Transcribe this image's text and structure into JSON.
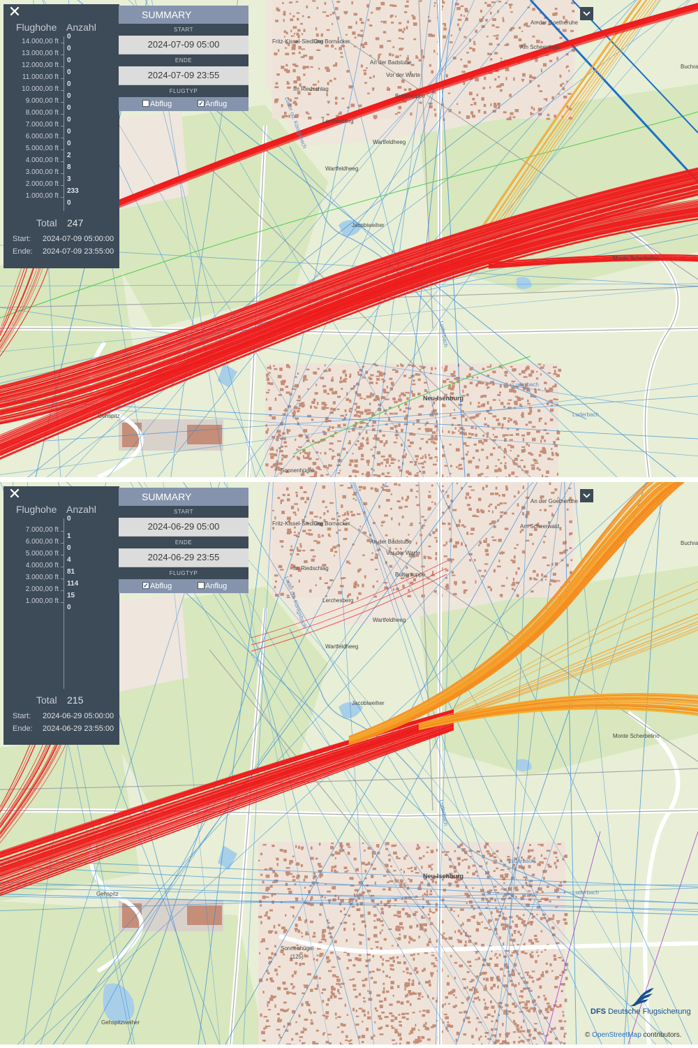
{
  "top_panel": {
    "header": {
      "col_altitude": "Flughohe",
      "col_count": "Anzahl"
    },
    "rows": [
      {
        "altitude": "14.000,00 ft",
        "count": "0"
      },
      {
        "altitude": "13.000,00 ft",
        "count": "0"
      },
      {
        "altitude": "12.000,00 ft",
        "count": "0"
      },
      {
        "altitude": "11.000,00 ft",
        "count": "0"
      },
      {
        "altitude": "10.000,00 ft",
        "count": "0"
      },
      {
        "altitude": "9.000,00 ft",
        "count": "0"
      },
      {
        "altitude": "8.000,00 ft",
        "count": "0"
      },
      {
        "altitude": "7.000,00 ft",
        "count": "0"
      },
      {
        "altitude": "6.000,00 ft",
        "count": "0"
      },
      {
        "altitude": "5.000,00 ft",
        "count": "0"
      },
      {
        "altitude": "4.000,00 ft",
        "count": "2"
      },
      {
        "altitude": "3.000,00 ft",
        "count": "8"
      },
      {
        "altitude": "2.000,00 ft",
        "count": "3"
      },
      {
        "altitude": "1.000,00 ft",
        "count": "233"
      },
      {
        "altitude": "",
        "count": "0"
      }
    ],
    "total_label": "Total",
    "total": "247",
    "start_label": "Start:",
    "start": "2024-07-09 05:00:00",
    "end_label": "Ende:",
    "end": "2024-07-09 23:55:00",
    "summary": {
      "title": "SUMMARY",
      "start_label": "START",
      "start": "2024-07-09 05:00",
      "end_label": "ENDE",
      "end": "2024-07-09 23:55",
      "type_label": "FLUGTYP",
      "departure_label": "Abflug",
      "departure_checked": false,
      "arrival_label": "Anflug",
      "arrival_checked": true
    }
  },
  "bottom_panel": {
    "header": {
      "col_altitude": "Flughohe",
      "col_count": "Anzahl"
    },
    "rows": [
      {
        "altitude": "",
        "count": "0"
      },
      {
        "altitude": "7.000,00 ft",
        "count": "1"
      },
      {
        "altitude": "6.000,00 ft",
        "count": "0"
      },
      {
        "altitude": "5.000,00 ft",
        "count": "4"
      },
      {
        "altitude": "4.000,00 ft",
        "count": "81"
      },
      {
        "altitude": "3.000,00 ft",
        "count": "114"
      },
      {
        "altitude": "2.000,00 ft",
        "count": "15"
      },
      {
        "altitude": "1.000,00 ft",
        "count": "0"
      }
    ],
    "total_label": "Total",
    "total": "215",
    "start_label": "Start:",
    "start": "2024-06-29 05:00:00",
    "end_label": "Ende:",
    "end": "2024-06-29 23:55:00",
    "summary": {
      "title": "SUMMARY",
      "start_label": "START",
      "start": "2024-06-29 05:00",
      "end_label": "ENDE",
      "end": "2024-06-29 23:55",
      "type_label": "FLUGTYP",
      "departure_label": "Abflug",
      "departure_checked": true,
      "arrival_label": "Anflug",
      "arrival_checked": false
    }
  },
  "map_labels_top": [
    "Fritz-Kissel-Siedlung",
    "Der Bornacker",
    "An der Badstube",
    "Vor der Warte",
    "Im Riedschlag",
    "Buttersuppe",
    "Lerchesberg",
    "Wartfeldheeg",
    "Wartfeldheeg",
    "Jacobiweiher",
    "Monte Scherbelino",
    "Neu-Isenburg",
    "Gehspitz",
    "Sonnenhügel",
    "Luderbach",
    "Luderbach",
    "Luderbach",
    "Luder od. Königsbach",
    "An der Goetheruhe",
    "Am Scheerwald",
    "Buchrain"
  ],
  "map_labels_bottom": [
    "Fritz-Kissel-Siedlung",
    "Der Bornacker",
    "An der Badstube",
    "Vor der Warte",
    "Im Riedschlag",
    "Buttersuppe",
    "Lerchesberg",
    "Wartfeldheeg",
    "Wartfeldheeg",
    "Jacobiweiher",
    "Monte Scherbelino",
    "Neu-Isenburg",
    "Gehspitz",
    "Sonnenhügel",
    "(125)",
    "Luderbach",
    "Luderbach",
    "Luderbach",
    "Luder od. Königsbach",
    "An der Goetheruhe",
    "Am Scheerwald",
    "Buchrain",
    "Gehspitzweiher"
  ],
  "branding": {
    "logo_abbr": "DFS",
    "logo_name": "Deutsche Flugsicherung",
    "attribution_prefix": "©",
    "attribution_link": "OpenStreetMap",
    "attribution_suffix": "contributors."
  },
  "colors": {
    "map_bg": "#e8efd6",
    "forest": "#d4e6b8",
    "urban": "#c58e78",
    "panel_bg": "#3d4a57",
    "header_bg": "#8593ad",
    "track_red": "#ee1c1c",
    "track_orange": "#f58a1f",
    "track_blue": "#2b86d9",
    "track_green": "#4ccc4c",
    "dfs_blue": "#1a4f8f"
  }
}
